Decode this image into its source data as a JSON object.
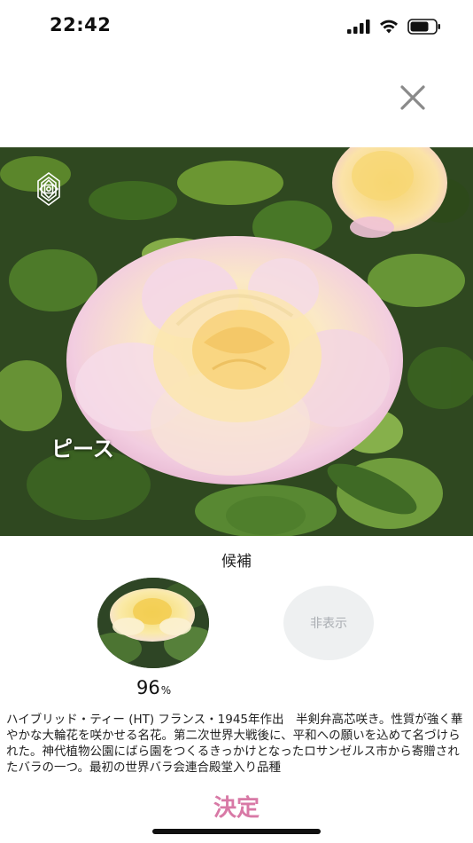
{
  "status_bar": {
    "time": "22:42"
  },
  "flower": {
    "name": "ピース"
  },
  "candidates": {
    "title": "候補",
    "score": "96",
    "score_unit": "%",
    "hide_label": "非表示"
  },
  "description": "ハイブリッド・ティー (HT) フランス・1945年作出　半剣弁高芯咲き。性質が強く華やかな大輪花を咲かせる名花。第二次世界大戦後に、平和への願いを込めて名づけられた。神代植物公園にばら園をつくるきっかけとなったロサンゼルス市から寄贈されたバラの一つ。最初の世界バラ会連合殿堂入り品種",
  "actions": {
    "decide_label": "決定"
  },
  "icons": {
    "signal": "cellular-signal-icon",
    "wifi": "wifi-icon",
    "battery": "battery-icon",
    "close": "close-icon",
    "rose": "rose-logo-icon"
  },
  "colors": {
    "accent": "#d879a6",
    "hide_bg": "#eef0f1",
    "hide_text": "#a9adb2"
  }
}
